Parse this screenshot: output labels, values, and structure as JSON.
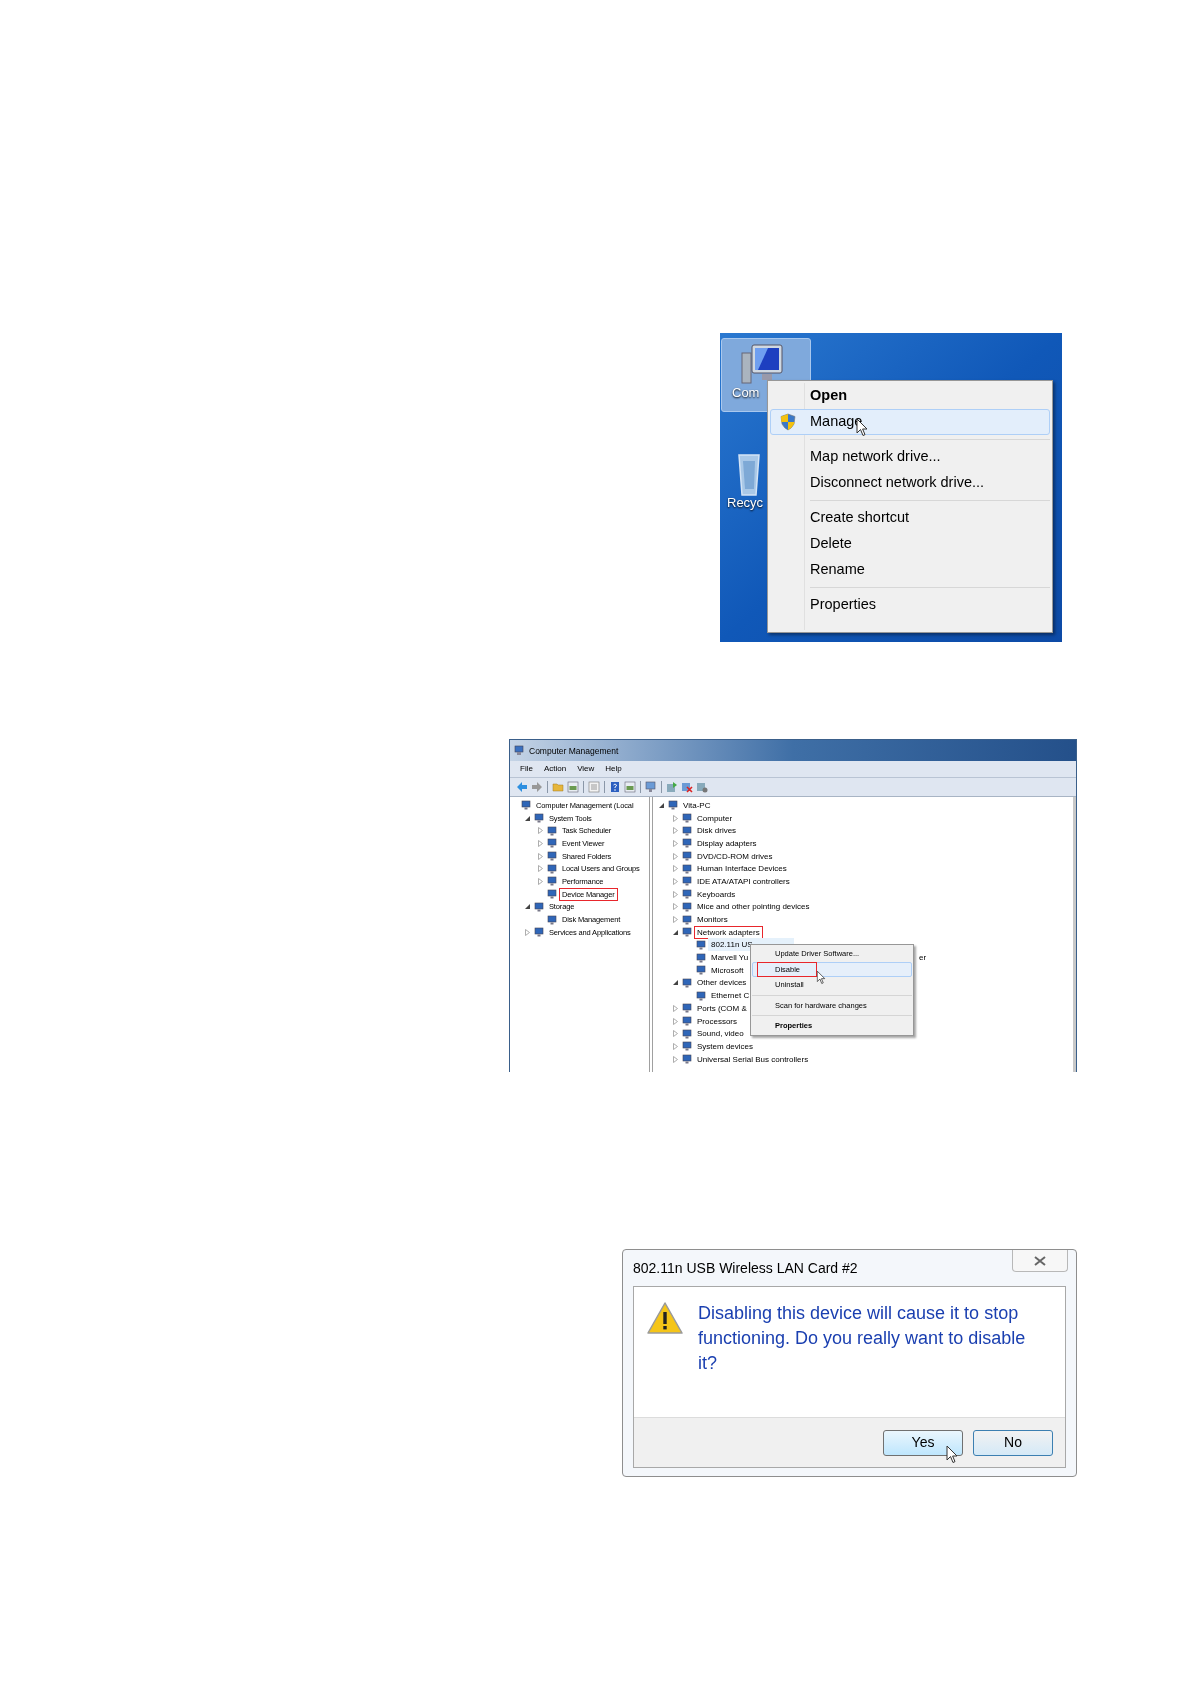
{
  "desktop_screenshot": {
    "icons": [
      {
        "label": "Com",
        "kind": "computer",
        "selected": true
      },
      {
        "label": "Recyc",
        "kind": "recycle-bin",
        "selected": false
      }
    ],
    "context_menu": {
      "sections": [
        {
          "items": [
            {
              "label": "Open",
              "bold": true,
              "shield": false,
              "selected": false
            },
            {
              "label": "Manage",
              "bold": false,
              "shield": true,
              "selected": true
            }
          ]
        },
        {
          "items": [
            {
              "label": "Map network drive...",
              "bold": false,
              "shield": false,
              "selected": false
            },
            {
              "label": "Disconnect network drive...",
              "bold": false,
              "shield": false,
              "selected": false
            }
          ]
        },
        {
          "items": [
            {
              "label": "Create shortcut",
              "bold": false,
              "shield": false,
              "selected": false
            },
            {
              "label": "Delete",
              "bold": false,
              "shield": false,
              "selected": false
            },
            {
              "label": "Rename",
              "bold": false,
              "shield": false,
              "selected": false
            }
          ]
        },
        {
          "items": [
            {
              "label": "Properties",
              "bold": false,
              "shield": false,
              "selected": false
            }
          ]
        }
      ]
    }
  },
  "computer_management": {
    "window": {
      "title": "Computer Management"
    },
    "menu_bar": [
      "File",
      "Action",
      "View",
      "Help"
    ],
    "navigation_tree": [
      {
        "label": "Computer Management (Local",
        "marked": false,
        "selected": false,
        "children": [
          {
            "label": "System Tools",
            "expanded": true,
            "marked": false,
            "selected": false,
            "children": [
              {
                "label": "Task Scheduler",
                "expanded": false,
                "marked": false,
                "selected": false
              },
              {
                "label": "Event Viewer",
                "expanded": false,
                "marked": false,
                "selected": false
              },
              {
                "label": "Shared Folders",
                "expanded": false,
                "marked": false,
                "selected": false
              },
              {
                "label": "Local Users and Groups",
                "expanded": false,
                "marked": false,
                "selected": false
              },
              {
                "label": "Performance",
                "expanded": false,
                "marked": false,
                "selected": false
              },
              {
                "label": "Device Manager",
                "marked": true,
                "selected": false
              }
            ]
          },
          {
            "label": "Storage",
            "expanded": true,
            "marked": false,
            "selected": false,
            "children": [
              {
                "label": "Disk Management",
                "marked": false,
                "selected": false
              }
            ]
          },
          {
            "label": "Services and Applications",
            "expanded": false,
            "marked": false,
            "selected": false
          }
        ]
      }
    ],
    "device_tree": [
      {
        "label": "Vita-PC",
        "expanded": true,
        "marked": false,
        "selected": false,
        "children": [
          {
            "label": "Computer",
            "expanded": false,
            "marked": false,
            "selected": false
          },
          {
            "label": "Disk drives",
            "expanded": false,
            "marked": false,
            "selected": false
          },
          {
            "label": "Display adapters",
            "expanded": false,
            "marked": false,
            "selected": false
          },
          {
            "label": "DVD/CD-ROM drives",
            "expanded": false,
            "marked": false,
            "selected": false
          },
          {
            "label": "Human Interface Devices",
            "expanded": false,
            "marked": false,
            "selected": false
          },
          {
            "label": "IDE ATA/ATAPI controllers",
            "expanded": false,
            "marked": false,
            "selected": false
          },
          {
            "label": "Keyboards",
            "expanded": false,
            "marked": false,
            "selected": false
          },
          {
            "label": "Mice and other pointing devices",
            "expanded": false,
            "marked": false,
            "selected": false
          },
          {
            "label": "Monitors",
            "expanded": false,
            "marked": false,
            "selected": false
          },
          {
            "label": "Network adapters",
            "expanded": true,
            "marked": true,
            "selected": false,
            "children": [
              {
                "label": "802.11n US",
                "marked": false,
                "selected": true
              },
              {
                "label": "Marvell Yu",
                "tail": "er",
                "marked": false,
                "selected": false
              },
              {
                "label": "Microsoft",
                "marked": false,
                "selected": false
              }
            ]
          },
          {
            "label": "Other devices",
            "expanded": true,
            "marked": false,
            "selected": false,
            "children": [
              {
                "label": "Ethernet C",
                "marked": false,
                "selected": false
              }
            ]
          },
          {
            "label": "Ports (COM &",
            "expanded": false,
            "marked": false,
            "selected": false
          },
          {
            "label": "Processors",
            "expanded": false,
            "marked": false,
            "selected": false
          },
          {
            "label": "Sound, video",
            "expanded": false,
            "marked": false,
            "selected": false
          },
          {
            "label": "System devices",
            "expanded": false,
            "marked": false,
            "selected": false
          },
          {
            "label": "Universal Serial Bus controllers",
            "expanded": false,
            "marked": false,
            "selected": false
          }
        ]
      }
    ],
    "context_menu": {
      "sections": [
        {
          "items": [
            {
              "label": "Update Driver Software...",
              "bold": false,
              "marked": false,
              "selected": false
            },
            {
              "label": "Disable",
              "bold": false,
              "marked": true,
              "selected": true
            },
            {
              "label": "Uninstall",
              "bold": false,
              "marked": false,
              "selected": false
            }
          ]
        },
        {
          "items": [
            {
              "label": "Scan for hardware changes",
              "bold": false,
              "marked": false,
              "selected": false
            }
          ]
        },
        {
          "items": [
            {
              "label": "Properties",
              "bold": true,
              "marked": false,
              "selected": false
            }
          ]
        }
      ]
    }
  },
  "confirm_dialog": {
    "title": "802.11n USB Wireless LAN Card #2",
    "message": "Disabling this device will cause it to stop functioning. Do you really want to disable it?",
    "buttons": [
      {
        "label": "Yes",
        "hovered": true,
        "default": false
      },
      {
        "label": "No",
        "hovered": false,
        "default": true
      }
    ]
  }
}
